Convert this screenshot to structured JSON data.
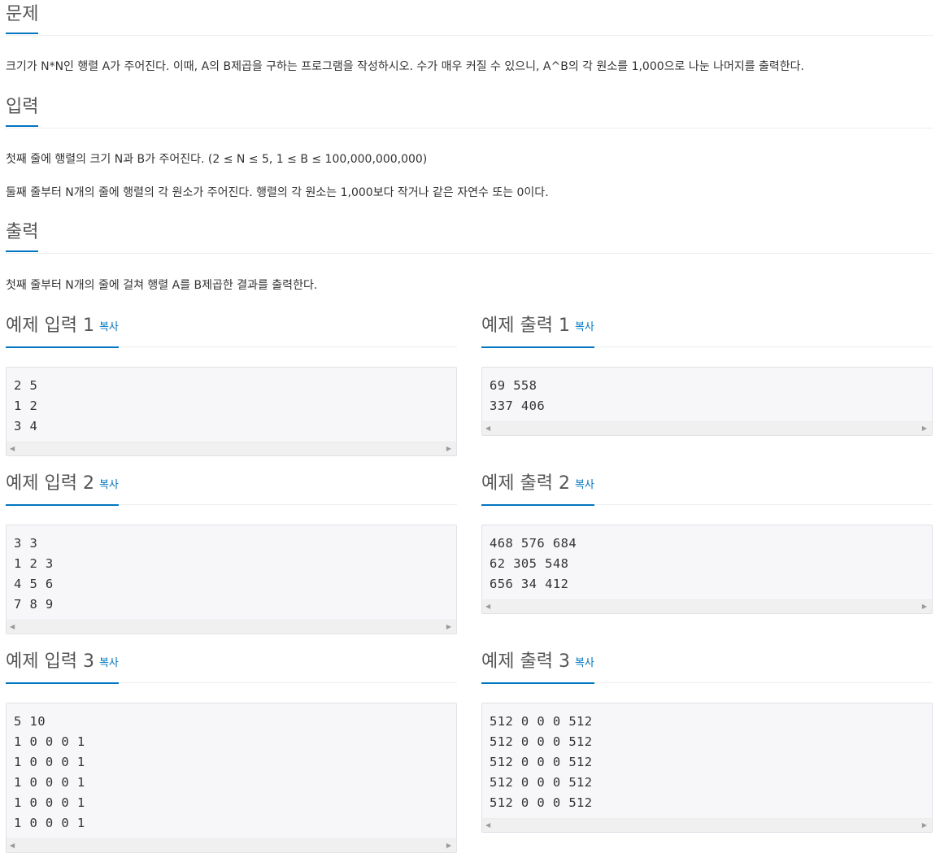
{
  "problem": {
    "heading": "문제",
    "description": "크기가 N*N인 행렬 A가 주어진다. 이때, A의 B제곱을 구하는 프로그램을 작성하시오. 수가 매우 커질 수 있으니, A^B의 각 원소를 1,000으로 나눈 나머지를 출력한다."
  },
  "input": {
    "heading": "입력",
    "line1": "첫째 줄에 행렬의 크기 N과 B가 주어진다. (2 ≤ N ≤  5, 1 ≤ B ≤ 100,000,000,000)",
    "line2": "둘째 줄부터 N개의 줄에 행렬의 각 원소가 주어진다. 행렬의 각 원소는 1,000보다 작거나 같은 자연수 또는 0이다."
  },
  "output": {
    "heading": "출력",
    "description": "첫째 줄부터 N개의 줄에 걸쳐 행렬 A를 B제곱한 결과를 출력한다."
  },
  "copy_label": "복사",
  "samples": {
    "in1": {
      "title": "예제 입력 1",
      "content": "2 5\n1 2\n3 4"
    },
    "out1": {
      "title": "예제 출력 1",
      "content": "69 558\n337 406"
    },
    "in2": {
      "title": "예제 입력 2",
      "content": "3 3\n1 2 3\n4 5 6\n7 8 9"
    },
    "out2": {
      "title": "예제 출력 2",
      "content": "468 576 684\n62 305 548\n656 34 412"
    },
    "in3": {
      "title": "예제 입력 3",
      "content": "5 10\n1 0 0 0 1\n1 0 0 0 1\n1 0 0 0 1\n1 0 0 0 1\n1 0 0 0 1"
    },
    "out3": {
      "title": "예제 출력 3",
      "content": "512 0 0 0 512\n512 0 0 0 512\n512 0 0 0 512\n512 0 0 0 512\n512 0 0 0 512"
    }
  },
  "colors": {
    "accent": "#0076c0",
    "code_bg": "#f7f7f9",
    "code_border": "#e1e1e8"
  }
}
